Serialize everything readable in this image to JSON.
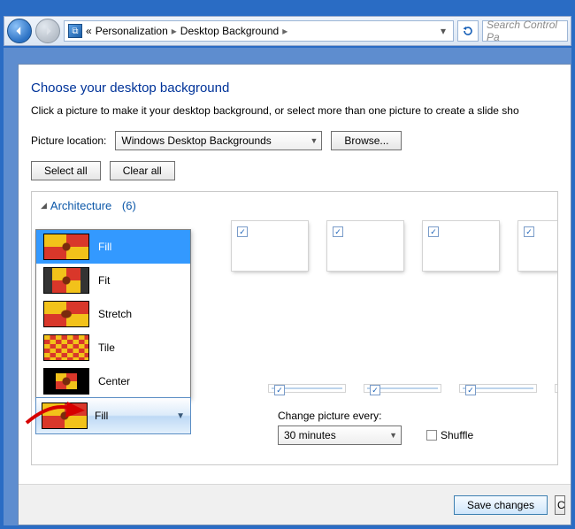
{
  "nav": {
    "back_icon": "back-arrow",
    "forward_icon": "forward-arrow",
    "breadcrumb_prefix": "«",
    "breadcrumb_parent": "Personalization",
    "breadcrumb_current": "Desktop Background",
    "search_placeholder": "Search Control Pa"
  },
  "heading": "Choose your desktop background",
  "subtitle": "Click a picture to make it your desktop background, or select more than one picture to create a slide sho",
  "picture_location": {
    "label": "Picture location:",
    "value": "Windows Desktop Backgrounds",
    "browse": "Browse..."
  },
  "select_all": "Select all",
  "clear_all": "Clear all",
  "group": {
    "name": "Architecture",
    "count": "(6)"
  },
  "thumbs": [
    {
      "checked": true
    },
    {
      "checked": true
    },
    {
      "checked": true
    },
    {
      "checked": true
    }
  ],
  "thumbs_row2_count": 4,
  "picture_position": {
    "options": [
      "Fill",
      "Fit",
      "Stretch",
      "Tile",
      "Center"
    ],
    "selected": "Fill"
  },
  "change_every": {
    "label": "Change picture every:",
    "value": "30 minutes"
  },
  "shuffle_label": "Shuffle",
  "save": "Save changes",
  "cancel": "C"
}
